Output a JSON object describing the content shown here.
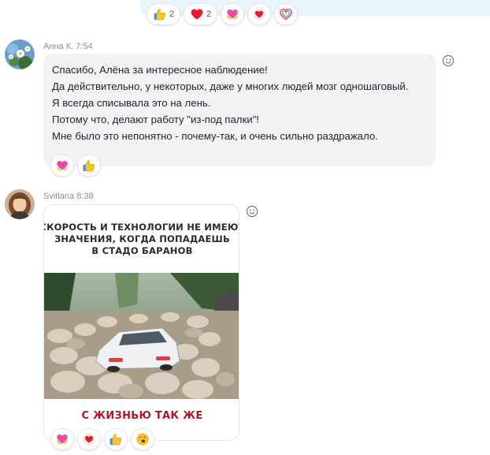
{
  "previous_message": {
    "reactions": [
      {
        "icon": "thumbs-up-icon",
        "count": "2"
      },
      {
        "icon": "heart-icon",
        "count": "2"
      },
      {
        "icon": "heart-hands-icon",
        "count": ""
      },
      {
        "icon": "heart-bubble-icon",
        "count": ""
      },
      {
        "icon": "rainbow-heart-icon",
        "count": ""
      }
    ]
  },
  "message1": {
    "author": "Анна К.",
    "time": "7:54",
    "lines": [
      "Спасибо, Алёна за интересное наблюдение!",
      "Да действительно,  у некоторых, даже у   многих людей мозг одношаговый.",
      "Я всегда списывала это на лень.",
      "Потому что, делают работу \"из-под палки\"!",
      "Мне было это непонятно - почему-так, и очень сильно раздражало."
    ],
    "reactions": [
      {
        "icon": "heart-hands-icon"
      },
      {
        "icon": "thumbs-up-icon"
      }
    ]
  },
  "message2": {
    "author": "Svitlana",
    "time": "8:38",
    "meme": {
      "top_text": [
        "СКОРОСТЬ И ТЕХНОЛОГИИ НЕ ИМЕЮТ",
        "ЗНАЧЕНИЯ, КОГДА ПОПАДАЕШЬ",
        "В СТАДО БАРАНОВ"
      ],
      "bottom_text": "С ЖИЗНЬЮ ТАК ЖЕ"
    },
    "reactions": [
      {
        "icon": "heart-hands-icon"
      },
      {
        "icon": "heart-bubble-icon"
      },
      {
        "icon": "thumbs-up-icon"
      },
      {
        "icon": "yawning-face-icon"
      }
    ]
  },
  "colors": {
    "bubble": "#f1f2f4",
    "previous_bubble": "#eaf4fb",
    "meme_red": "#b3162a",
    "heart_red": "#e31b2e",
    "thumb_yellow": "#f7c52b",
    "pink": "#e84aa6"
  }
}
